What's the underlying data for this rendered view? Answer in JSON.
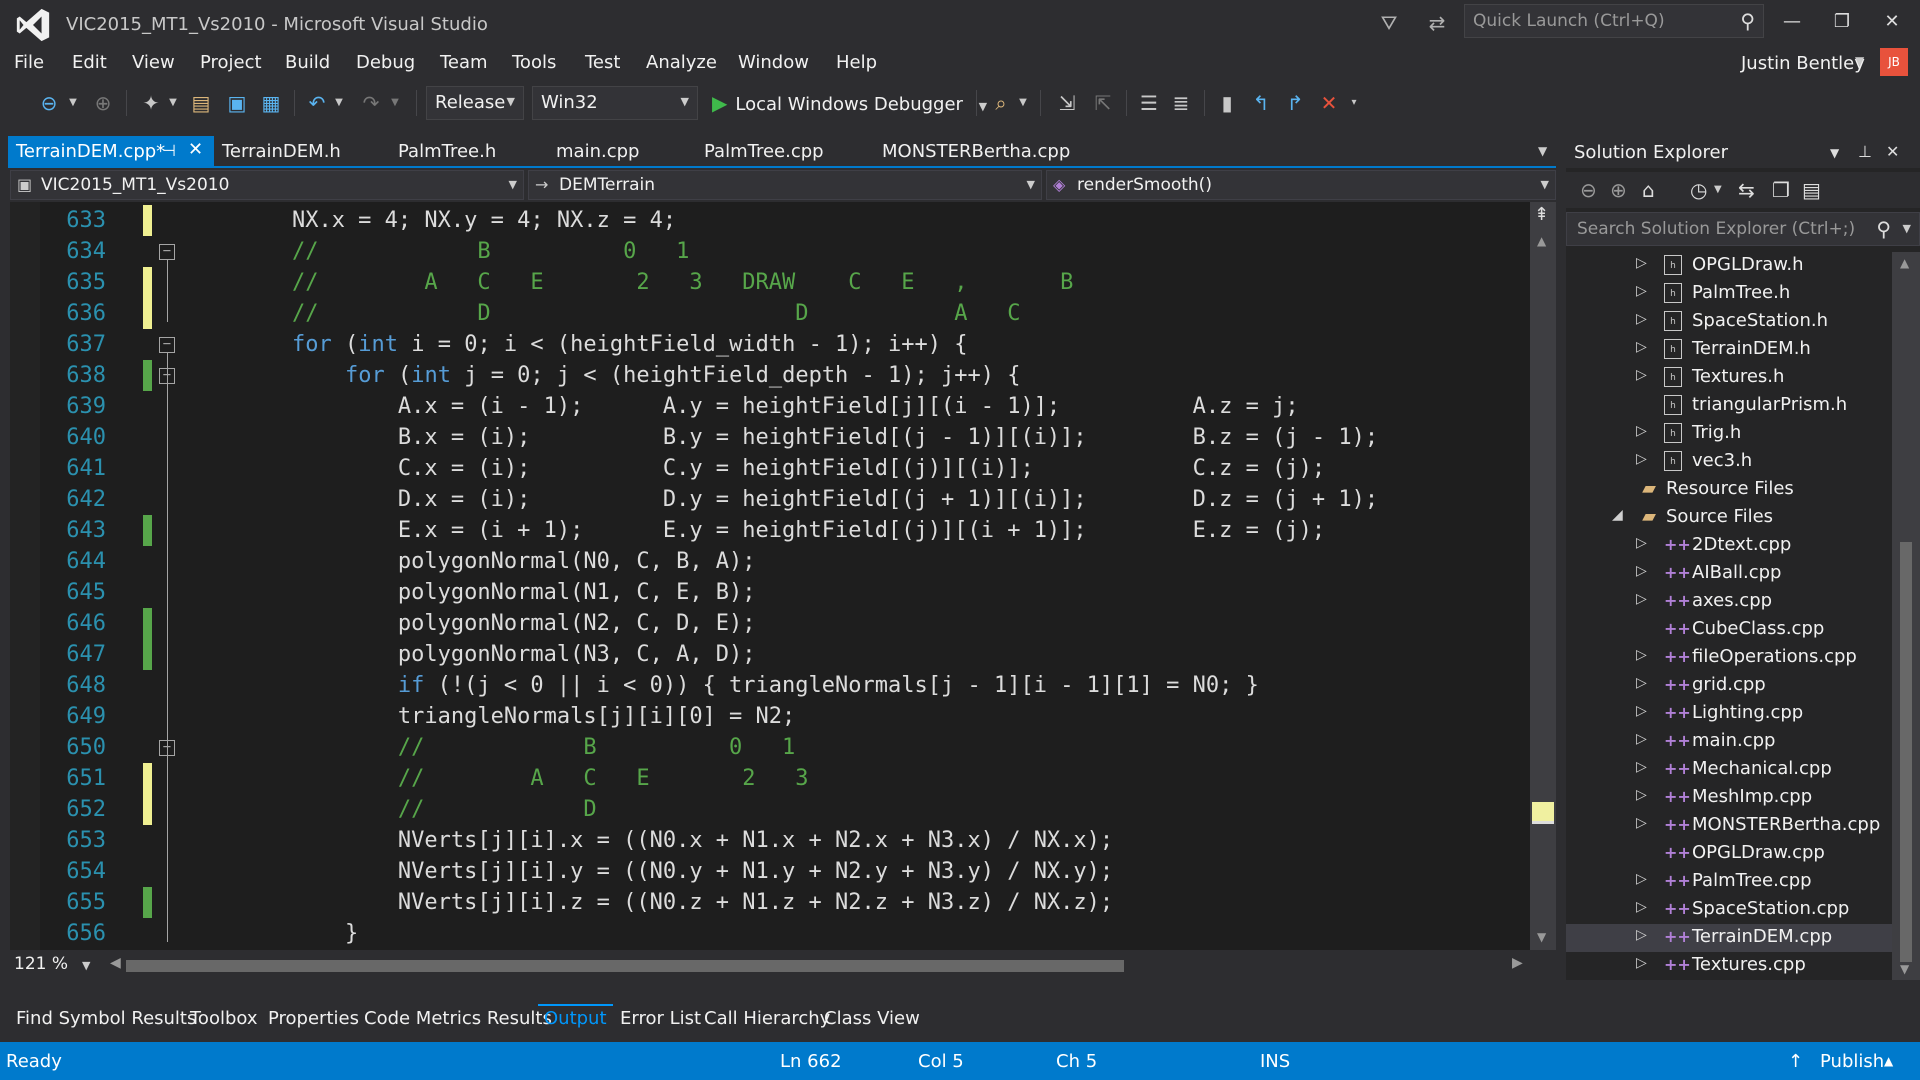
{
  "window": {
    "title": "VIC2015_MT1_Vs2010 - Microsoft Visual Studio",
    "quick_launch_placeholder": "Quick Launch (Ctrl+Q)"
  },
  "menu": [
    "File",
    "Edit",
    "View",
    "Project",
    "Build",
    "Debug",
    "Team",
    "Tools",
    "Test",
    "Analyze",
    "Window",
    "Help"
  ],
  "user": {
    "name": "Justin Bentley",
    "initials": "JB"
  },
  "toolbar": {
    "configuration": "Release",
    "platform": "Win32",
    "debugger_label": "Local Windows Debugger"
  },
  "tabs": [
    {
      "label": "TerrainDEM.cpp*",
      "active": true
    },
    {
      "label": "TerrainDEM.h"
    },
    {
      "label": "PalmTree.h"
    },
    {
      "label": "main.cpp"
    },
    {
      "label": "PalmTree.cpp"
    },
    {
      "label": "MONSTERBertha.cpp"
    }
  ],
  "nav": {
    "project": "VIC2015_MT1_Vs2010",
    "scope": "DEMTerrain",
    "member": "renderSmooth()"
  },
  "code_lines": [
    {
      "num": "633",
      "text": "        NX.x = 4; NX.y = 4; NX.z = 4;"
    },
    {
      "num": "634",
      "text": "        //            B          0   1"
    },
    {
      "num": "635",
      "text": "        //        A   C   E       2   3   DRAW    C   E   ,       B"
    },
    {
      "num": "636",
      "text": "        //            D                       D           A   C"
    },
    {
      "num": "637",
      "text": "        for (int i = 0; i < (heightField_width - 1); i++) {"
    },
    {
      "num": "638",
      "text": "            for (int j = 0; j < (heightField_depth - 1); j++) {"
    },
    {
      "num": "639",
      "text": "                A.x = (i - 1);      A.y = heightField[j][(i - 1)];          A.z = j;"
    },
    {
      "num": "640",
      "text": "                B.x = (i);          B.y = heightField[(j - 1)][(i)];        B.z = (j - 1);"
    },
    {
      "num": "641",
      "text": "                C.x = (i);          C.y = heightField[(j)][(i)];            C.z = (j);"
    },
    {
      "num": "642",
      "text": "                D.x = (i);          D.y = heightField[(j + 1)][(i)];        D.z = (j + 1);"
    },
    {
      "num": "643",
      "text": "                E.x = (i + 1);      E.y = heightField[(j)][(i + 1)];        E.z = (j);"
    },
    {
      "num": "644",
      "text": "                polygonNormal(N0, C, B, A);"
    },
    {
      "num": "645",
      "text": "                polygonNormal(N1, C, E, B);"
    },
    {
      "num": "646",
      "text": "                polygonNormal(N2, C, D, E);"
    },
    {
      "num": "647",
      "text": "                polygonNormal(N3, C, A, D);"
    },
    {
      "num": "648",
      "text": "                if (!(j < 0 || i < 0)) { triangleNormals[j - 1][i - 1][1] = N0; }"
    },
    {
      "num": "649",
      "text": "                triangleNormals[j][i][0] = N2;"
    },
    {
      "num": "650",
      "text": "                //            B          0   1"
    },
    {
      "num": "651",
      "text": "                //        A   C   E       2   3"
    },
    {
      "num": "652",
      "text": "                //            D"
    },
    {
      "num": "653",
      "text": "                NVerts[j][i].x = ((N0.x + N1.x + N2.x + N3.x) / NX.x);"
    },
    {
      "num": "654",
      "text": "                NVerts[j][i].y = ((N0.y + N1.y + N2.y + N3.y) / NX.y);"
    },
    {
      "num": "655",
      "text": "                NVerts[j][i].z = ((N0.z + N1.z + N2.z + N3.z) / NX.z);"
    },
    {
      "num": "656",
      "text": "            }"
    }
  ],
  "editor": {
    "zoom": "121 %"
  },
  "solution_explorer": {
    "title": "Solution Explorer",
    "search_placeholder": "Search Solution Explorer (Ctrl+;)",
    "items": [
      {
        "label": "OPGLDraw.h",
        "type": "h",
        "arrow": "▷"
      },
      {
        "label": "PalmTree.h",
        "type": "h",
        "arrow": "▷"
      },
      {
        "label": "SpaceStation.h",
        "type": "h",
        "arrow": "▷"
      },
      {
        "label": "TerrainDEM.h",
        "type": "h",
        "arrow": "▷"
      },
      {
        "label": "Textures.h",
        "type": "h",
        "arrow": "▷"
      },
      {
        "label": "triangularPrism.h",
        "type": "h",
        "arrow": ""
      },
      {
        "label": "Trig.h",
        "type": "h",
        "arrow": "▷"
      },
      {
        "label": "vec3.h",
        "type": "h",
        "arrow": "▷"
      },
      {
        "label": "Resource Files",
        "type": "folder",
        "arrow": ""
      },
      {
        "label": "Source Files",
        "type": "folder",
        "arrow": "◢"
      },
      {
        "label": "2Dtext.cpp",
        "type": "cpp",
        "arrow": "▷"
      },
      {
        "label": "AIBall.cpp",
        "type": "cpp",
        "arrow": "▷"
      },
      {
        "label": "axes.cpp",
        "type": "cpp",
        "arrow": "▷"
      },
      {
        "label": "CubeClass.cpp",
        "type": "cpp",
        "arrow": ""
      },
      {
        "label": "fileOperations.cpp",
        "type": "cpp",
        "arrow": "▷"
      },
      {
        "label": "grid.cpp",
        "type": "cpp",
        "arrow": "▷"
      },
      {
        "label": "Lighting.cpp",
        "type": "cpp",
        "arrow": "▷"
      },
      {
        "label": "main.cpp",
        "type": "cpp",
        "arrow": "▷"
      },
      {
        "label": "Mechanical.cpp",
        "type": "cpp",
        "arrow": "▷"
      },
      {
        "label": "MeshImp.cpp",
        "type": "cpp",
        "arrow": "▷"
      },
      {
        "label": "MONSTERBertha.cpp",
        "type": "cpp",
        "arrow": "▷"
      },
      {
        "label": "OPGLDraw.cpp",
        "type": "cpp",
        "arrow": ""
      },
      {
        "label": "PalmTree.cpp",
        "type": "cpp",
        "arrow": "▷"
      },
      {
        "label": "SpaceStation.cpp",
        "type": "cpp",
        "arrow": "▷"
      },
      {
        "label": "TerrainDEM.cpp",
        "type": "cpp",
        "arrow": "▷",
        "selected": true
      },
      {
        "label": "Textures.cpp",
        "type": "cpp",
        "arrow": "▷"
      }
    ]
  },
  "bottom_tabs": [
    {
      "label": "Find Symbol Results"
    },
    {
      "label": "Toolbox"
    },
    {
      "label": "Properties"
    },
    {
      "label": "Code Metrics Results"
    },
    {
      "label": "Output",
      "active": true
    },
    {
      "label": "Error List"
    },
    {
      "label": "Call Hierarchy"
    },
    {
      "label": "Class View"
    }
  ],
  "status": {
    "state": "Ready",
    "line": "Ln 662",
    "col": "Col 5",
    "ch": "Ch 5",
    "mode": "INS",
    "publish": "Publish"
  },
  "colors": {
    "accent": "#007acc",
    "keyword": "#569cd6",
    "comment": "#57a64a",
    "line_number": "#2b91af"
  }
}
